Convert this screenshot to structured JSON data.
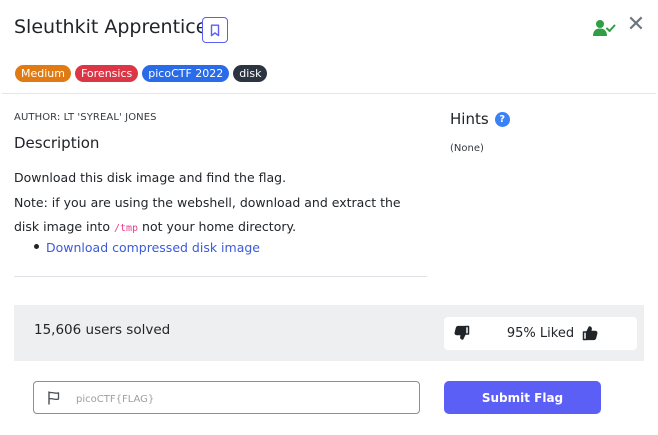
{
  "header": {
    "title": "Sleuthkit Apprentice",
    "bookmark_icon": "bookmark-icon",
    "user_status_icon": "user-check-icon",
    "close_icon": "close-icon",
    "close_glyph": "✕"
  },
  "tags": [
    {
      "label": "Medium",
      "color": "#e07a12"
    },
    {
      "label": "Forensics",
      "color": "#dc3545"
    },
    {
      "label": "picoCTF 2022",
      "color": "#2a6be8"
    },
    {
      "label": "disk",
      "color": "#2b3440"
    }
  ],
  "challenge": {
    "author": "AUTHOR: LT 'SYREAL' JONES",
    "description_heading": "Description",
    "line1": "Download this disk image and find the flag.",
    "line2_before": "Note: if you are using the webshell, download and extract the disk image into ",
    "line2_code": "/tmp",
    "line2_after": " not your home directory.",
    "download_link": "Download compressed disk image"
  },
  "hints": {
    "heading": "Hints",
    "help_glyph": "?",
    "value": "(None)"
  },
  "stats": {
    "solved": "15,606 users solved",
    "liked": "95% Liked",
    "thumbs_down_icon": "thumbs-down-icon",
    "thumbs_up_icon": "thumbs-up-icon"
  },
  "submit": {
    "placeholder": "picoCTF{FLAG}",
    "value": "",
    "button_label": "Submit Flag",
    "flag_icon": "flag-icon"
  },
  "colors": {
    "accent": "#5b5ff5",
    "link": "#3b5bdb",
    "user_check": "#2f9e44"
  }
}
